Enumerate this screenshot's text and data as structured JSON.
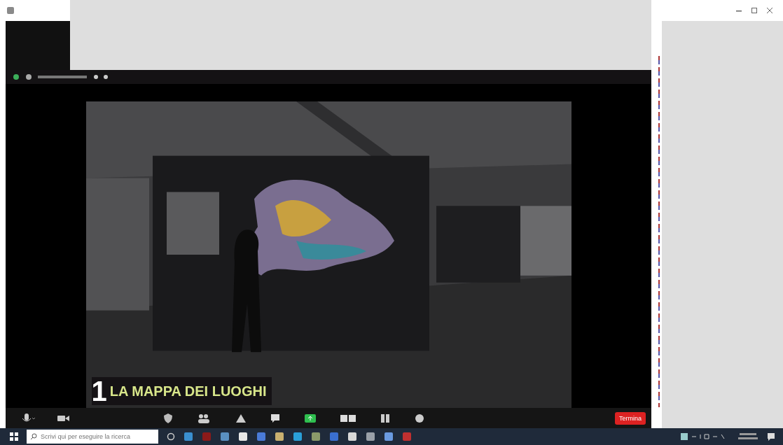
{
  "shared_screen": {
    "caption": {
      "number": "1",
      "title": "LA MAPPA DEI LUOGHI"
    }
  },
  "toolbar": {
    "left": [
      {
        "kind": "mic"
      },
      {
        "kind": "video"
      }
    ],
    "center": [
      {
        "kind": "security"
      },
      {
        "kind": "participants"
      },
      {
        "kind": "polls"
      },
      {
        "kind": "chat"
      },
      {
        "kind": "share"
      },
      {
        "kind": "layout"
      },
      {
        "kind": "grid"
      },
      {
        "kind": "reactions"
      }
    ],
    "end_button": "Termina"
  },
  "taskbar": {
    "search": {
      "placeholder": "Scrivi qui per eseguire la ricerca"
    },
    "apps": [
      {
        "color": "#3a8fd0"
      },
      {
        "color": "#8b1a1a"
      },
      {
        "color": "#5a8fc0"
      },
      {
        "color": "#e8e8e8"
      },
      {
        "color": "#4a7bd8"
      },
      {
        "color": "#c8b070"
      },
      {
        "color": "#2a9fd8"
      },
      {
        "color": "#8a9a6a"
      },
      {
        "color": "#3a6fd0"
      },
      {
        "color": "#d8d8d8"
      },
      {
        "color": "#9aa0a8"
      },
      {
        "color": "#6a9ae0"
      },
      {
        "color": "#c03030"
      }
    ]
  }
}
